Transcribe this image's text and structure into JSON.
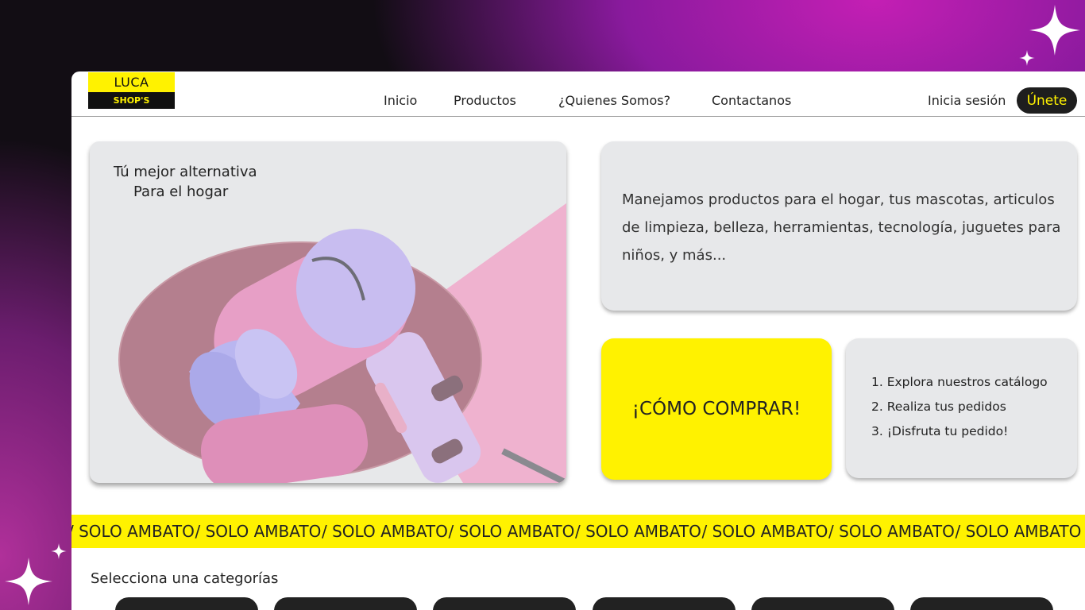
{
  "brand": {
    "logo_top": "LUCA",
    "logo_bottom": "SHOP'S"
  },
  "nav": {
    "items": [
      "Inicio",
      "Productos",
      "¿Quienes Somos?",
      "Contactanos"
    ],
    "login": "Inicia sesión",
    "join": "Únete"
  },
  "hero": {
    "line1": "Tú mejor alternativa",
    "line2": "Para el hogar"
  },
  "description": "Manejamos productos para el hogar, tus mascotas, articulos de limpieza, belleza, herramientas, tecnología, juguetes para niños, y más...",
  "buy_card": {
    "label": "¡CÓMO COMPRAR!"
  },
  "steps": [
    "1. Explora nuestros catálogo",
    "2. Realiza tus pedidos",
    "3. ¡Disfruta tu pedido!"
  ],
  "ticker": {
    "text": "/ SOLO AMBATO"
  },
  "categories": {
    "title": "Selecciona una categorías"
  },
  "colors": {
    "accent": "#fff200",
    "dark": "#1e1e1e",
    "card": "#e7e8ea"
  }
}
